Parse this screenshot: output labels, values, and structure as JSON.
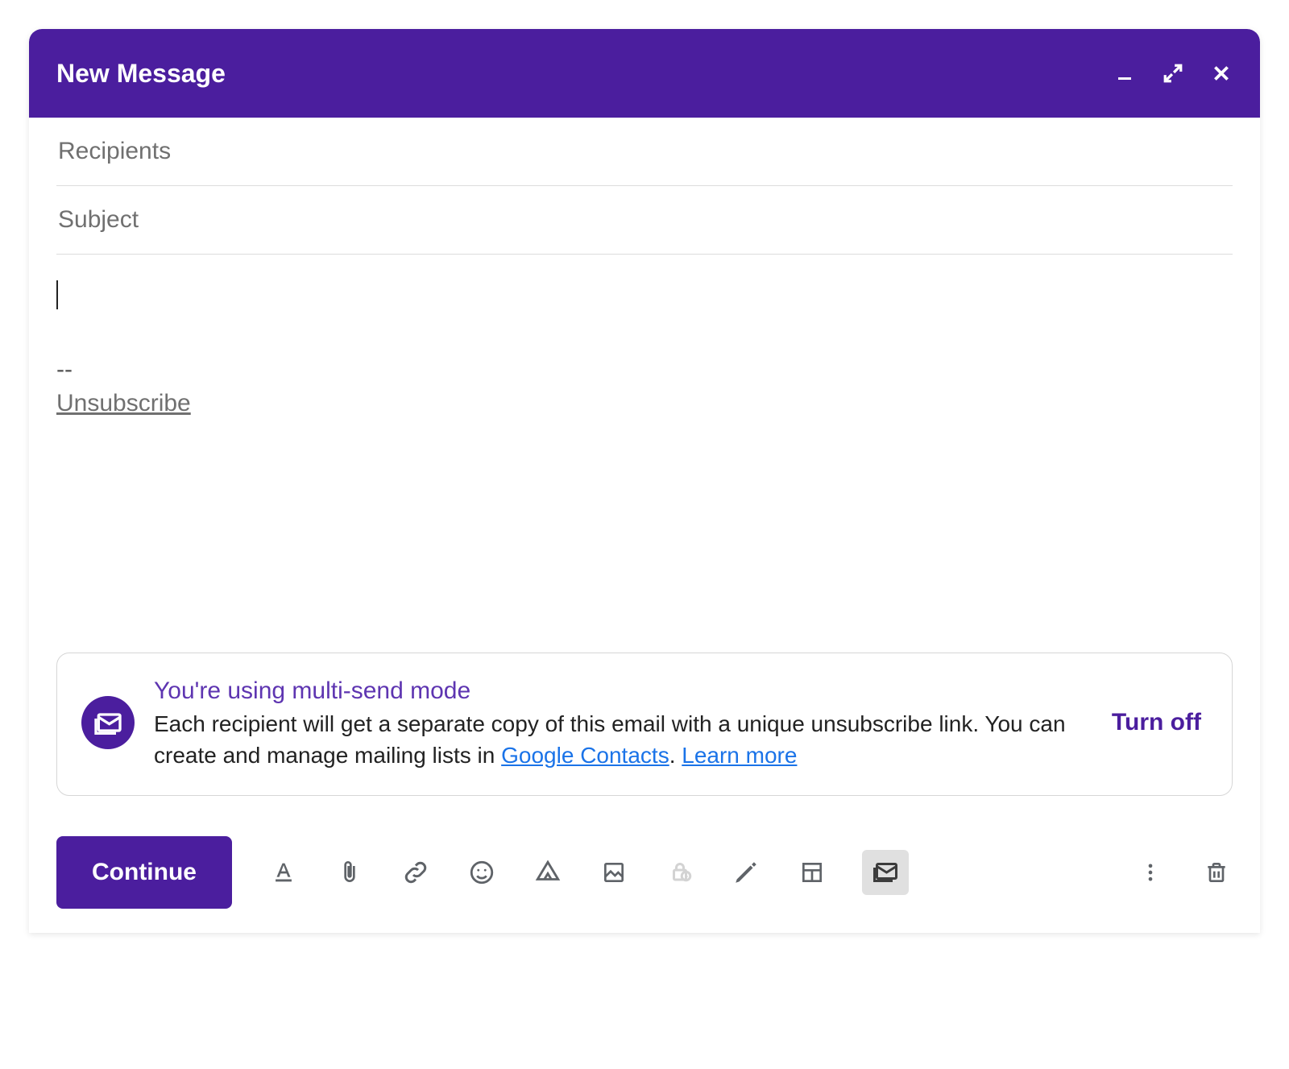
{
  "header": {
    "title": "New Message"
  },
  "fields": {
    "recipients_placeholder": "Recipients",
    "recipients_value": "",
    "subject_placeholder": "Subject",
    "subject_value": ""
  },
  "body": {
    "signature_separator": "--",
    "unsubscribe_label": "Unsubscribe"
  },
  "notice": {
    "title": "You're using multi-send mode",
    "desc_1": "Each recipient will get a separate copy of this email with a unique unsubscribe link. You can create and manage mailing lists in ",
    "contacts_link": "Google Contacts",
    "desc_sep": ". ",
    "learn_more": "Learn more",
    "action_label": "Turn off"
  },
  "toolbar": {
    "send_label": "Continue"
  },
  "icons": {
    "minimize": "minimize",
    "fullscreen": "fullscreen",
    "close": "close",
    "format": "format",
    "attach": "attach",
    "link": "link",
    "emoji": "emoji",
    "drive": "drive",
    "image": "image",
    "confidential": "confidential",
    "signature": "signature",
    "template": "template",
    "multisend": "multisend",
    "more": "more",
    "trash": "trash"
  }
}
